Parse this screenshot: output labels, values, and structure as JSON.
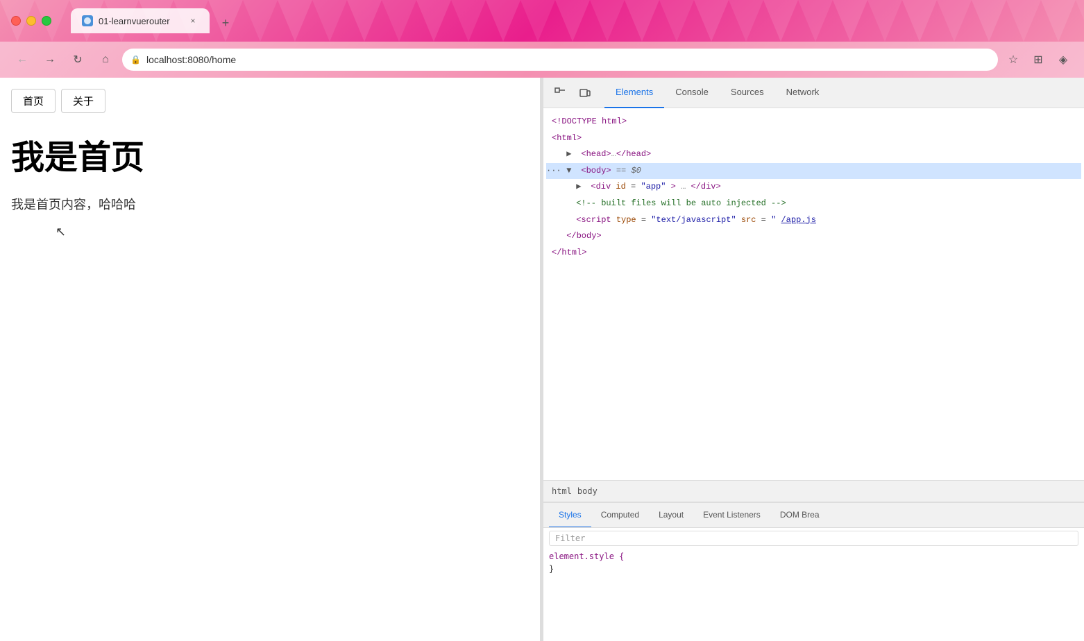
{
  "browser": {
    "tab_title": "01-learnvuerouter",
    "tab_close": "×",
    "new_tab": "+",
    "address": "localhost:8080/home",
    "traffic_lights": {
      "close": "close",
      "minimize": "minimize",
      "maximize": "maximize"
    }
  },
  "nav": {
    "back": "←",
    "forward": "→",
    "reload": "↻",
    "home": "⌂"
  },
  "page": {
    "nav_buttons": [
      {
        "label": "首页",
        "id": "home-btn"
      },
      {
        "label": "关于",
        "id": "about-btn"
      }
    ],
    "heading": "我是首页",
    "body_text": "我是首页内容，哈哈哈"
  },
  "devtools": {
    "tabs": [
      {
        "label": "Elements",
        "id": "elements",
        "active": true
      },
      {
        "label": "Console",
        "id": "console",
        "active": false
      },
      {
        "label": "Sources",
        "id": "sources",
        "active": false
      },
      {
        "label": "Network",
        "id": "network",
        "active": false
      }
    ],
    "dom_lines": [
      {
        "text": "<!DOCTYPE html>",
        "type": "doctype",
        "indent": 0
      },
      {
        "text": "<html>",
        "type": "tag",
        "indent": 0
      },
      {
        "text": "▶ <head>…</head>",
        "type": "collapsed",
        "indent": 1
      },
      {
        "text": "<body> == $0",
        "type": "selected",
        "indent": 1
      },
      {
        "text": "▶ <div id=\"app\">…</div>",
        "type": "collapsed",
        "indent": 2
      },
      {
        "text": "<!-- built files will be auto injected -->",
        "type": "comment",
        "indent": 2
      },
      {
        "text": "<script type=\"text/javascript\" src=\"/app.js",
        "type": "script",
        "indent": 2
      },
      {
        "text": "</body>",
        "type": "close",
        "indent": 1
      },
      {
        "text": "</html>",
        "type": "close",
        "indent": 0
      }
    ],
    "breadcrumbs": [
      "html",
      "body"
    ],
    "bottom_tabs": [
      {
        "label": "Styles",
        "active": true
      },
      {
        "label": "Computed",
        "active": false
      },
      {
        "label": "Layout",
        "active": false
      },
      {
        "label": "Event Listeners",
        "active": false
      },
      {
        "label": "DOM Brea",
        "active": false
      }
    ],
    "filter_placeholder": "Filter",
    "css_rule": "element.style {",
    "css_rule_close": "}"
  }
}
